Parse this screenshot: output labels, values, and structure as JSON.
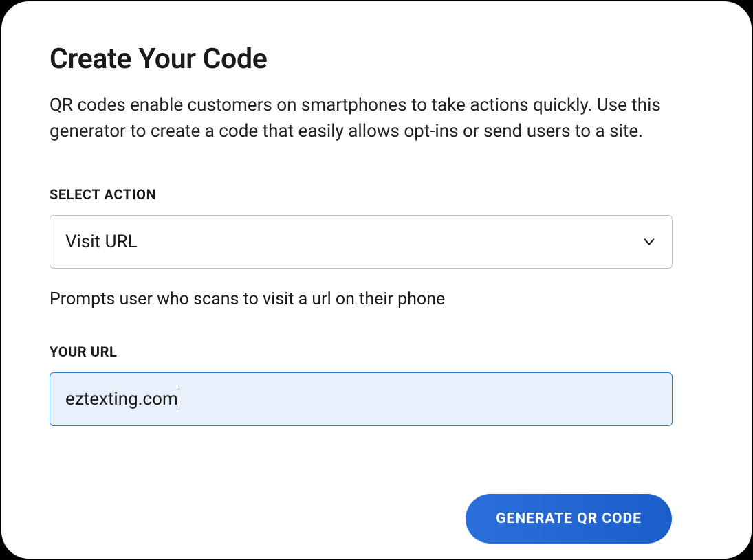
{
  "header": {
    "title": "Create Your Code",
    "description": "QR codes enable customers on smartphones to take actions quickly. Use this generator to create a code that easily allows opt-ins or send users to a site."
  },
  "action_field": {
    "label": "SELECT ACTION",
    "selected": "Visit URL",
    "helper": "Prompts user who scans to visit a url on their phone"
  },
  "url_field": {
    "label": "YOUR URL",
    "value": "eztexting.com"
  },
  "buttons": {
    "generate": "GENERATE QR CODE"
  }
}
